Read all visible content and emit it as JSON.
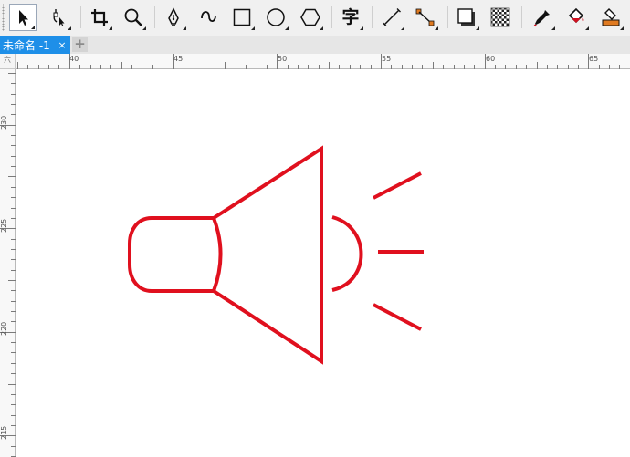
{
  "toolbar": {
    "tools": [
      {
        "name": "pick-tool",
        "icon": "arrow-pointer-icon"
      },
      {
        "name": "shape-tool",
        "icon": "node-edit-icon"
      },
      {
        "name": "crop-tool",
        "icon": "crop-icon"
      },
      {
        "name": "zoom-tool",
        "icon": "magnifier-icon"
      },
      {
        "name": "pen-tool",
        "icon": "pen-nib-icon"
      },
      {
        "name": "curve-tool",
        "icon": "artistic-curve-icon"
      },
      {
        "name": "rectangle-tool",
        "icon": "rectangle-icon"
      },
      {
        "name": "ellipse-tool",
        "icon": "ellipse-icon"
      },
      {
        "name": "polygon-tool",
        "icon": "hexagon-icon"
      },
      {
        "name": "text-tool",
        "icon": "text-glyph-icon"
      },
      {
        "name": "dimension-tool",
        "icon": "dimension-line-icon"
      },
      {
        "name": "connector-tool",
        "icon": "connector-icon"
      },
      {
        "name": "drop-shadow-tool",
        "icon": "drop-shadow-icon"
      },
      {
        "name": "transparency-tool",
        "icon": "checkerboard-icon"
      },
      {
        "name": "eyedropper-tool",
        "icon": "eyedropper-icon"
      },
      {
        "name": "interactive-fill-tool",
        "icon": "paint-bucket-icon"
      },
      {
        "name": "smart-fill-tool",
        "icon": "smart-fill-icon"
      }
    ],
    "text_tool_glyph": "字"
  },
  "tabs": [
    {
      "title": "未命名 -1",
      "close": "×",
      "active": true
    }
  ],
  "new_tab_label": "+",
  "ruler_corner_label": "六",
  "ruler": {
    "horizontal_ticks": [
      "40",
      "45",
      "50",
      "55",
      "60",
      "65"
    ],
    "vertical_ticks": [
      "230",
      "225",
      "220",
      "215"
    ]
  },
  "drawing": {
    "stroke_color": "#e0101e",
    "object": "speaker-icon"
  },
  "colors": {
    "accent_tab": "#1e8fe8",
    "toolbar_bg": "#f0f0f0",
    "shape_stroke": "#e0101e"
  }
}
